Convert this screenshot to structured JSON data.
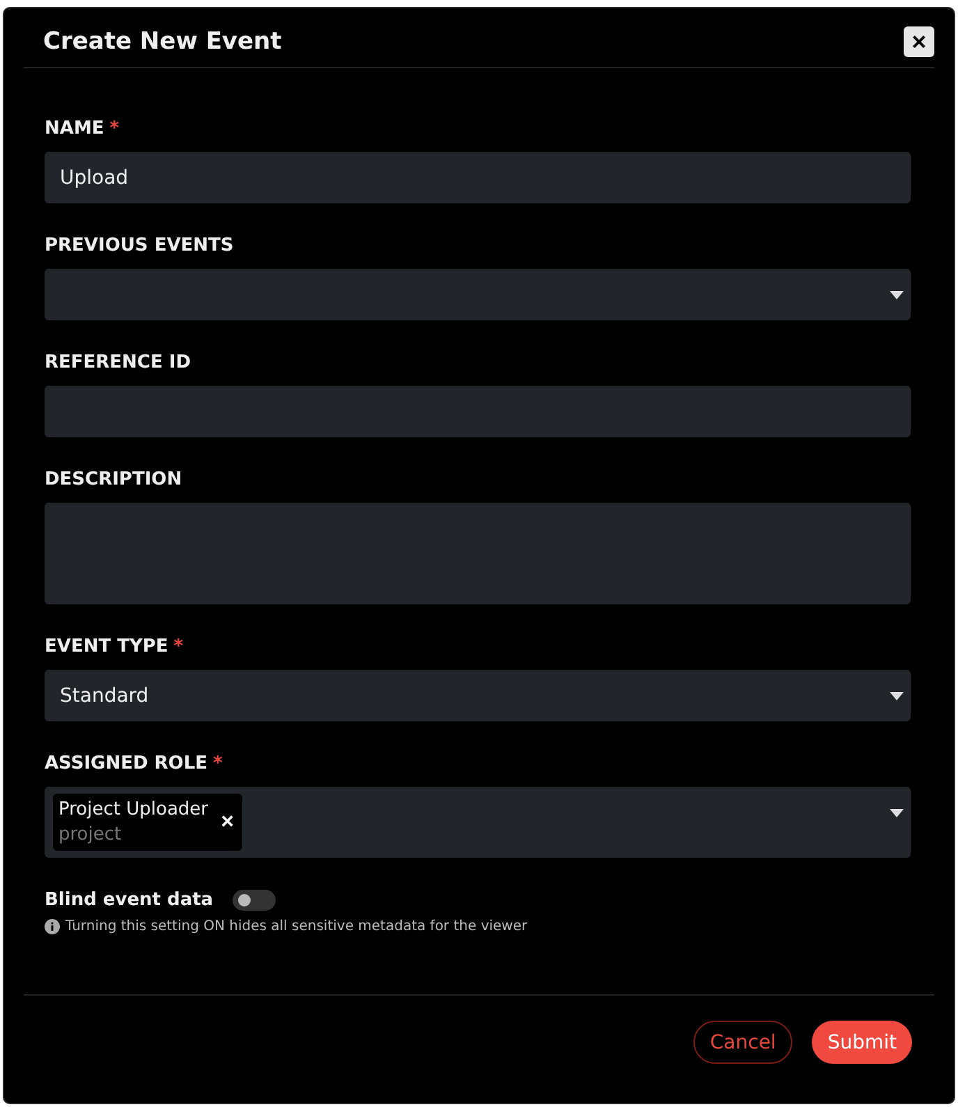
{
  "dialog": {
    "title": "Create New Event",
    "close": "×"
  },
  "fields": [
    {
      "kind": "text",
      "label": "NAME",
      "required_mark": "*",
      "value": "Upload"
    },
    {
      "kind": "select",
      "label": "PREVIOUS EVENTS"
    },
    {
      "kind": "text",
      "label": "REFERENCE ID"
    },
    {
      "kind": "textarea",
      "label": "DESCRIPTION"
    },
    {
      "kind": "select",
      "label": "EVENT TYPE",
      "required_mark": "*",
      "value": "Standard"
    },
    {
      "kind": "tags",
      "label": "ASSIGNED ROLE",
      "required_mark": "*",
      "tags": [
        {
          "title": "Project Uploader",
          "subtitle": "project",
          "remove": "×"
        }
      ]
    }
  ],
  "toggle": {
    "label": "Blind event data",
    "on": false,
    "hint": "Turning this setting ON hides all sensitive metadata for the viewer"
  },
  "buttons": [
    {
      "kind": "secondary",
      "label": "Cancel"
    },
    {
      "kind": "primary",
      "label": "Submit"
    }
  ]
}
